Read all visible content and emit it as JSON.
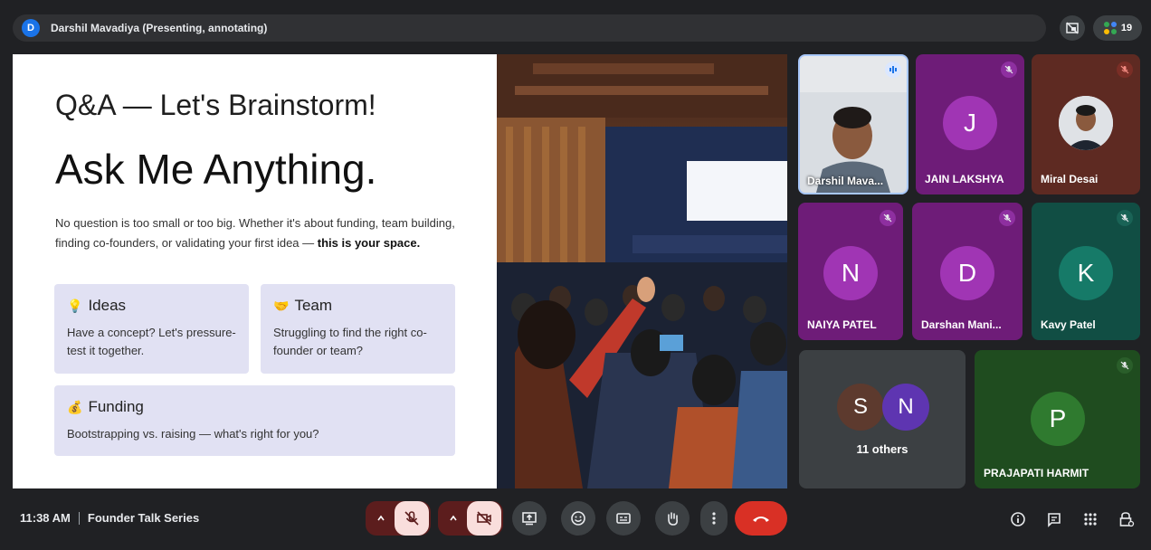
{
  "presenter_bar": {
    "initial": "D",
    "title": "Darshil Mavadiya (Presenting, annotating)"
  },
  "top_right": {
    "participant_count": "19"
  },
  "slide": {
    "title_small": "Q&A — Let's Brainstorm!",
    "title_big": "Ask Me Anything.",
    "intro_plain": "No question is too small or too big. Whether it's about funding, team building, finding co-founders, or validating your first idea — ",
    "intro_bold": "this is your space.",
    "cards": {
      "ideas": {
        "emoji": "💡",
        "title": "Ideas",
        "body": "Have a concept? Let's pressure-test it together."
      },
      "team": {
        "emoji": "🤝",
        "title": "Team",
        "body": "Struggling to find the right co-founder or team?"
      },
      "funding": {
        "emoji": "💰",
        "title": "Funding",
        "body": "Bootstrapping vs. raising — what's right for you?"
      }
    }
  },
  "participants": [
    {
      "name": "Darshil Mava...",
      "type": "video",
      "status": "speaking-icon"
    },
    {
      "name": "JAIN LAKSHYA",
      "initial": "J",
      "bg": "#6e1c78",
      "avatar": "#a035b4",
      "status": "mic-off-icon"
    },
    {
      "name": "Miral Desai",
      "type": "photo",
      "bg": "#5e2a22",
      "status": "mic-off-icon"
    },
    {
      "name": "NAIYA PATEL",
      "initial": "N",
      "bg": "#6e1c78",
      "avatar": "#a035b4",
      "status": "mic-off-icon"
    },
    {
      "name": "Darshan Mani...",
      "initial": "D",
      "bg": "#6e1c78",
      "avatar": "#a035b4",
      "status": "mic-off-icon"
    },
    {
      "name": "Kavy Patel",
      "initial": "K",
      "bg": "#114e44",
      "avatar": "#167a68",
      "status": "mic-off-icon"
    },
    {
      "name": "PRAJAPATI HARMIT",
      "initial": "P",
      "bg": "#1f4c1f",
      "avatar": "#2f7a2f",
      "status": "mic-off-icon"
    }
  ],
  "others": {
    "initials": [
      "S",
      "N"
    ],
    "label": "11 others"
  },
  "bottom_bar": {
    "time": "11:38 AM",
    "meeting_name": "Founder Talk Series"
  },
  "colors": {
    "end_call": "#d93025",
    "disabled_pill": "#f9dedc",
    "background": "#202124"
  }
}
